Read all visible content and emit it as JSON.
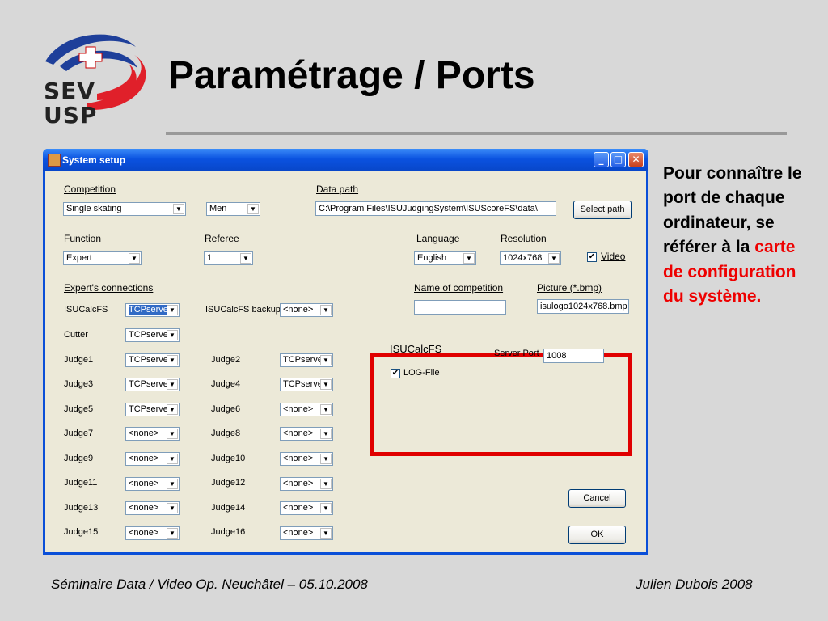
{
  "slide": {
    "title": "Paramétrage / Ports",
    "logo_line1": "SEV",
    "logo_line2": "USP",
    "side_note_prefix": "Pour connaître le port de chaque ordinateur, se référer à la",
    "side_note_highlight": "carte de configuration du système.",
    "footer_left": "Séminaire Data / Video Op. Neuchâtel – 05.10.2008",
    "footer_right": "Julien Dubois 2008"
  },
  "window": {
    "title": "System setup",
    "min_icon": "_",
    "max_icon": "□",
    "close_icon": "✕"
  },
  "setup": {
    "competition_label": "Competition",
    "competition_value": "Single skating",
    "gender_value": "Men",
    "data_path_label": "Data path",
    "data_path_value": "C:\\Program Files\\ISUJudgingSystem\\ISUScoreFS\\data\\",
    "select_path_button": "Select path",
    "function_label": "Function",
    "function_value": "Expert",
    "referee_label": "Referee",
    "referee_value": "1",
    "language_label": "Language",
    "language_value": "English",
    "resolution_label": "Resolution",
    "resolution_value": "1024x768",
    "video_label": "Video",
    "video_checked": "✔",
    "expert_connections_label": "Expert's connections",
    "name_of_competition_label": "Name of competition",
    "name_of_competition_value": "",
    "picture_label": "Picture (*.bmp)",
    "picture_value": "isulogo1024x768.bmp",
    "isucalcfs_label": "ISUCalcFS",
    "isucalcfs_value": "TCPserver",
    "isucalcfs_backup_label": "ISUCalcFS backup",
    "isucalcfs_backup_value": "<none>",
    "cutter_label": "Cutter",
    "cutter_value": "TCPserver",
    "judges": [
      {
        "label": "Judge1",
        "value": "TCPserver"
      },
      {
        "label": "Judge2",
        "value": "TCPserver"
      },
      {
        "label": "Judge3",
        "value": "TCPserver"
      },
      {
        "label": "Judge4",
        "value": "TCPserver"
      },
      {
        "label": "Judge5",
        "value": "TCPserver"
      },
      {
        "label": "Judge6",
        "value": "<none>"
      },
      {
        "label": "Judge7",
        "value": "<none>"
      },
      {
        "label": "Judge8",
        "value": "<none>"
      },
      {
        "label": "Judge9",
        "value": "<none>"
      },
      {
        "label": "Judge10",
        "value": "<none>"
      },
      {
        "label": "Judge11",
        "value": "<none>"
      },
      {
        "label": "Judge12",
        "value": "<none>"
      },
      {
        "label": "Judge13",
        "value": "<none>"
      },
      {
        "label": "Judge14",
        "value": "<none>"
      },
      {
        "label": "Judge15",
        "value": "<none>"
      },
      {
        "label": "Judge16",
        "value": "<none>"
      }
    ],
    "panel_title": "ISUCalcFS",
    "server_port_label": "Server Port",
    "server_port_value": "1008",
    "log_file_label": "LOG-File",
    "log_file_checked": "✔",
    "cancel_button": "Cancel",
    "ok_button": "OK",
    "dropdown_arrow": "▼"
  },
  "colors": {
    "highlight_red": "#e00000",
    "xp_blue": "#0a52e0"
  }
}
